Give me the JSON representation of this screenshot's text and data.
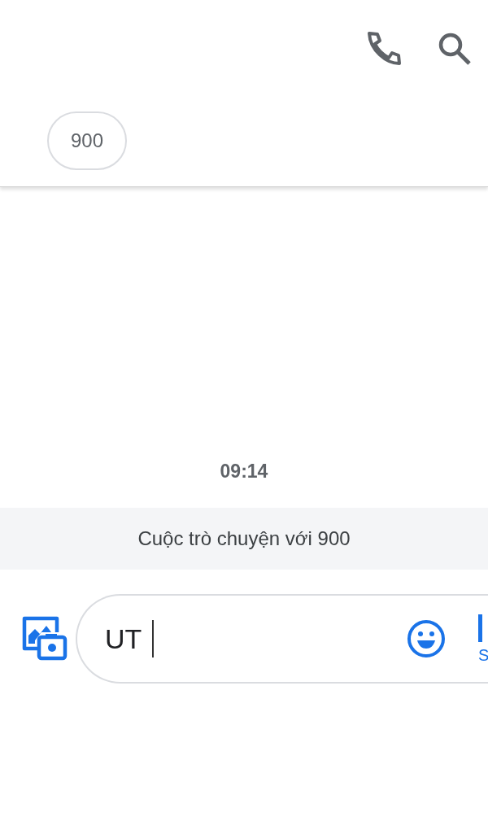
{
  "header": {
    "chip": "900"
  },
  "conversation": {
    "timestamp": "09:14",
    "banner": "Cuộc trò chuyện với 900"
  },
  "compose": {
    "value": "UT",
    "send_label": "S"
  }
}
